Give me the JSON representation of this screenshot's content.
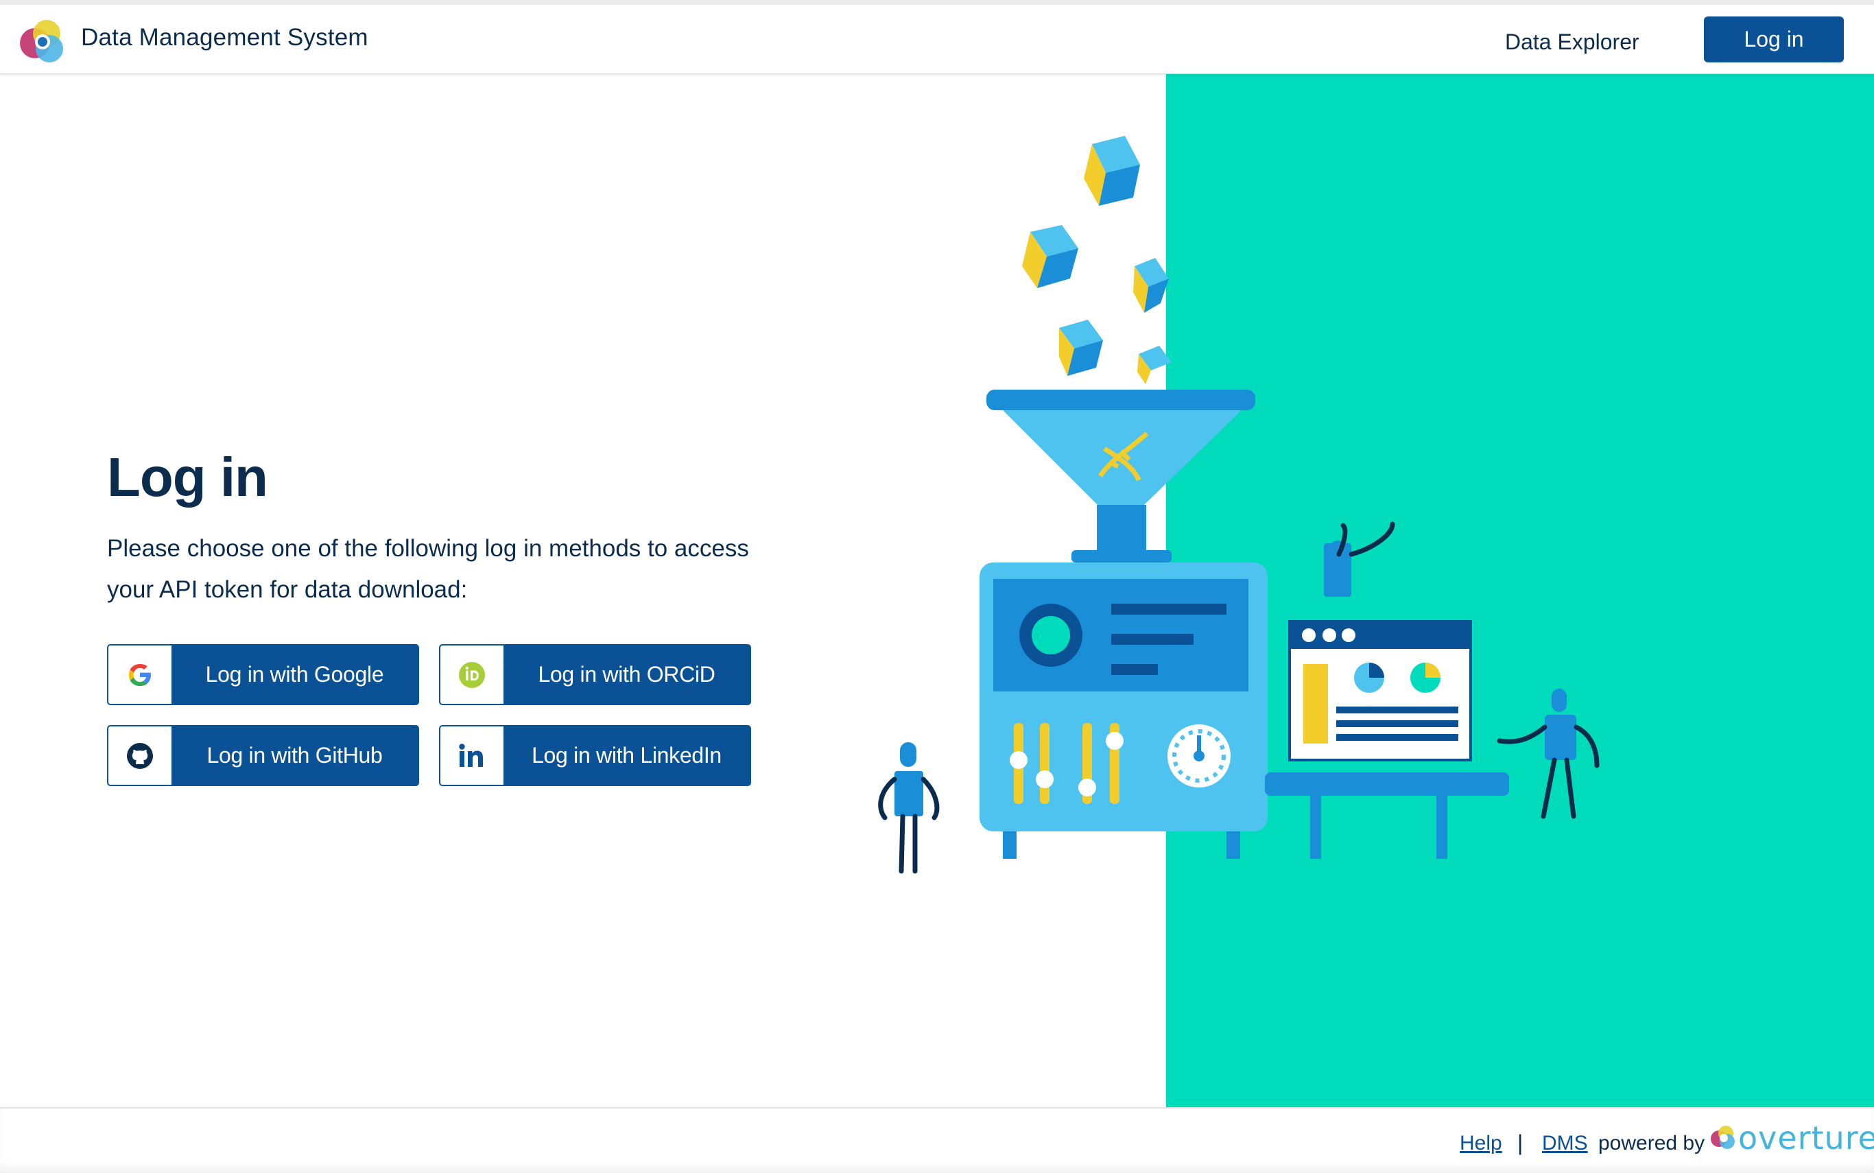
{
  "header": {
    "app_title": "Data Management System",
    "nav_link": "Data Explorer",
    "login_button": "Log in"
  },
  "main": {
    "title": "Log in",
    "intro": "Please choose one of the following log in methods to access your API token for data download:",
    "providers": [
      {
        "label": "Log in with Google",
        "icon": "google-icon"
      },
      {
        "label": "Log in with ORCiD",
        "icon": "orcid-icon"
      },
      {
        "label": "Log in with GitHub",
        "icon": "github-icon"
      },
      {
        "label": "Log in with LinkedIn",
        "icon": "linkedin-icon"
      }
    ]
  },
  "footer": {
    "help": "Help",
    "separator": "|",
    "dms": "DMS",
    "powered_by": "powered by",
    "brand": "overture"
  },
  "colors": {
    "primary": "#0b5196",
    "text": "#0b2c4d",
    "teal": "#00dbbc",
    "light_blue": "#4fc3f0",
    "mid_blue": "#1a8fd8",
    "yellow": "#f2cd2b"
  }
}
